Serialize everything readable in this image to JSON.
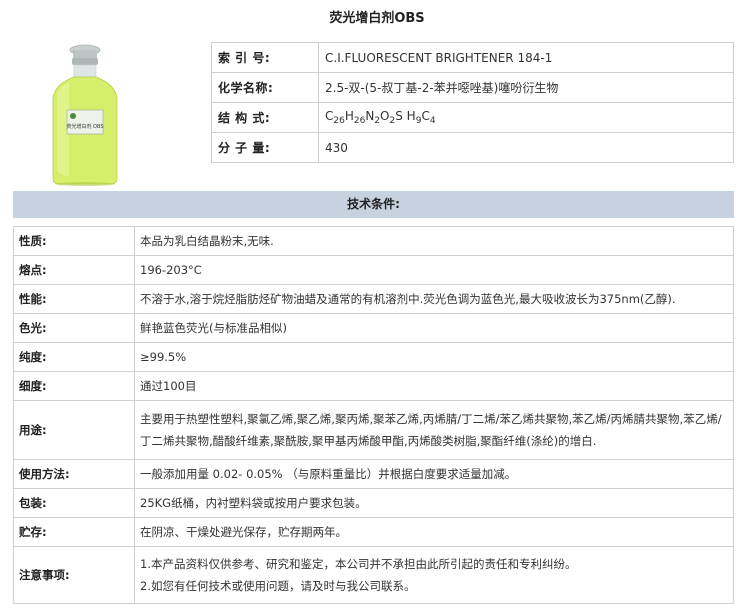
{
  "title": "荧光增白剂OBS",
  "info_rows": [
    {
      "label": "索 引 号:",
      "value": "C.I.FLUORESCENT BRIGHTENER 184-1"
    },
    {
      "label": "化学名称:",
      "value": "2.5-双-(5-叔丁基-2-苯并噁唑基)噻吩衍生物"
    },
    {
      "label": "结 构 式:",
      "formula_parts": [
        "C",
        "26",
        "H",
        "26",
        "N",
        "2",
        "O",
        "2",
        "S H",
        "9",
        "C",
        "4"
      ]
    },
    {
      "label": "分 子 量:",
      "value": "430"
    }
  ],
  "section_header": "技术条件:",
  "spec_rows": [
    {
      "label": "性质:",
      "value": "本品为乳白结晶粉末,无味."
    },
    {
      "label": "熔点:",
      "value": "196-203°C"
    },
    {
      "label": "性能:",
      "value": "不溶于水,溶于烷烃脂肪烃矿物油蜡及通常的有机溶剂中.荧光色调为蓝色光,最大吸收波长为375nm(乙醇)."
    },
    {
      "label": "色光:",
      "value": "鲜艳蓝色荧光(与标准品相似)"
    },
    {
      "label": "纯度:",
      "value": "≥99.5%"
    },
    {
      "label": "细度:",
      "value": "通过100目"
    },
    {
      "label": "用途:",
      "value": "主要用于热塑性塑料,聚氯乙烯,聚乙烯,聚丙烯,聚苯乙烯,丙烯腈/丁二烯/苯乙烯共聚物,苯乙烯/丙烯腈共聚物,苯乙烯/丁二烯共聚物,醋酸纤维素,聚酰胺,聚甲基丙烯酸甲酯,丙烯酸类树脂,聚酯纤维(涤纶)的增白."
    },
    {
      "label": "使用方法:",
      "value": "一般添加用量 0.02- 0.05% （与原料重量比）并根据白度要求适量加减。"
    },
    {
      "label": "包装:",
      "value": "25KG纸桶，内衬塑料袋或按用户要求包装。"
    },
    {
      "label": "贮存:",
      "value": "在阴凉、干燥处避光保存，贮存期两年。"
    },
    {
      "label": "注意事项:",
      "lines": [
        "1.本产品资料仅供参考、研究和鉴定，本公司并不承担由此所引起的责任和专利纠纷。",
        "2.如您有任何技术或使用问题，请及时与我公司联系。"
      ]
    }
  ],
  "bottle_label": "荧光增白剂 OBS",
  "colors": {
    "banner": "#c7d2e0",
    "border": "#cfcfcf",
    "powder": "#d6ee6a",
    "cap": "#b9c3c2"
  }
}
